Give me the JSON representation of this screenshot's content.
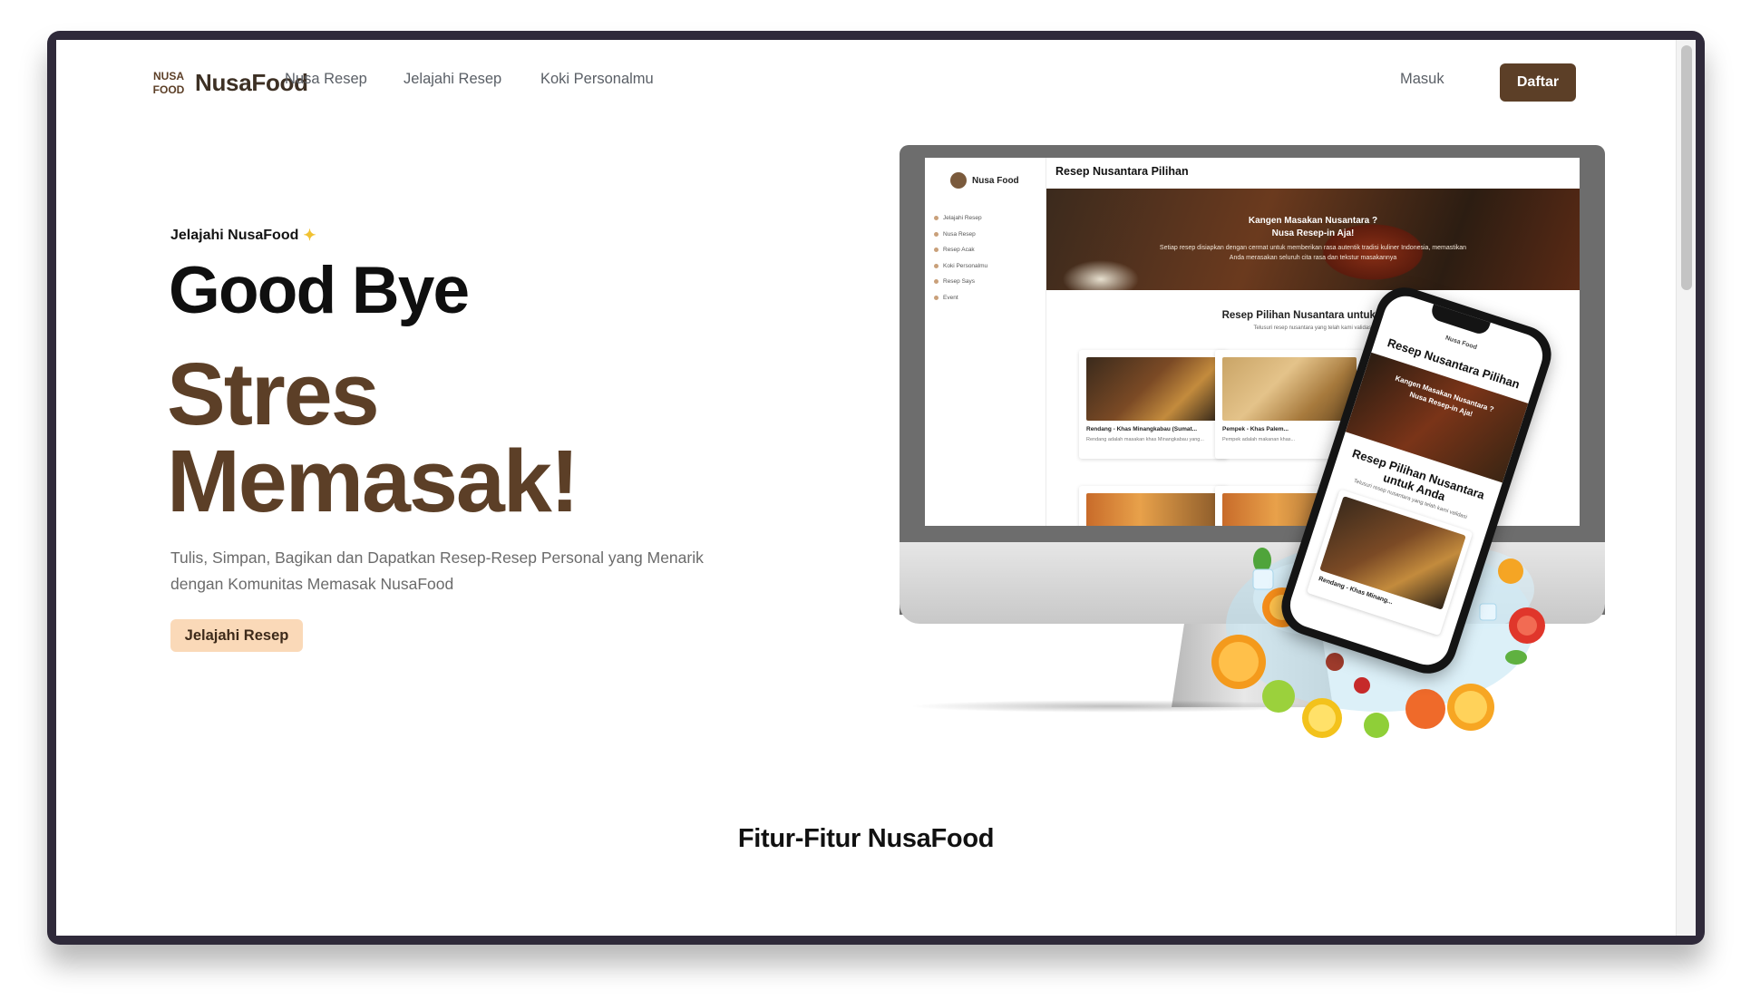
{
  "brand": {
    "name": "NusaFood",
    "logo_text": "NUSA FOOD"
  },
  "nav": {
    "links": [
      "Nusa Resep",
      "Jelajahi Resep",
      "Koki Personalmu"
    ],
    "login": "Masuk",
    "register": "Daftar"
  },
  "hero": {
    "eyebrow": "Jelajahi NusaFood",
    "headline": "Good Bye",
    "accent_line1": "Stres",
    "accent_line2": "Memasak!",
    "subtitle": "Tulis, Simpan, Bagikan dan Dapatkan Resep-Resep Personal yang Menarik dengan Komunitas Memasak NusaFood",
    "cta": "Jelajahi Resep"
  },
  "features": {
    "title": "Fitur-Fitur NusaFood"
  },
  "mockup": {
    "app_brand": "Nusa Food",
    "menu": [
      "Jelajahi Resep",
      "Nusa Resep",
      "Resep Acak",
      "Koki Personalmu",
      "Resep Says",
      "Event"
    ],
    "page_title": "Resep Nusantara Pilihan",
    "banner_title1": "Kangen Masakan Nusantara ?",
    "banner_title2": "Nusa Resep-in Aja!",
    "banner_text": "Setiap resep disiapkan dengan cermat untuk memberikan rasa autentik tradisi kuliner Indonesia, memastikan Anda merasakan seluruh cita rasa dan tekstur masakannya",
    "section_title": "Resep Pilihan Nusantara untuk Anda",
    "section_sub": "Telusuri resep nusantara yang telah kami validasi",
    "cards": [
      {
        "title": "Rendang - Khas Minangkabau (Sumat...",
        "desc": "Rendang adalah masakan khas Minangkabau yang..."
      },
      {
        "title": "Pempek - Khas Palem...",
        "desc": "Pempek adalah makanan khas..."
      }
    ],
    "phone_brand": "Nusa Food",
    "phone_title": "Resep Nusantara Pilihan",
    "phone_section": "Resep Pilihan Nusantara untuk Anda",
    "phone_card": "Rendang - Khas Minang..."
  },
  "colors": {
    "brand_brown": "#5c3f27",
    "cta_peach": "#fad9b8",
    "frame": "#2f2a3a"
  }
}
